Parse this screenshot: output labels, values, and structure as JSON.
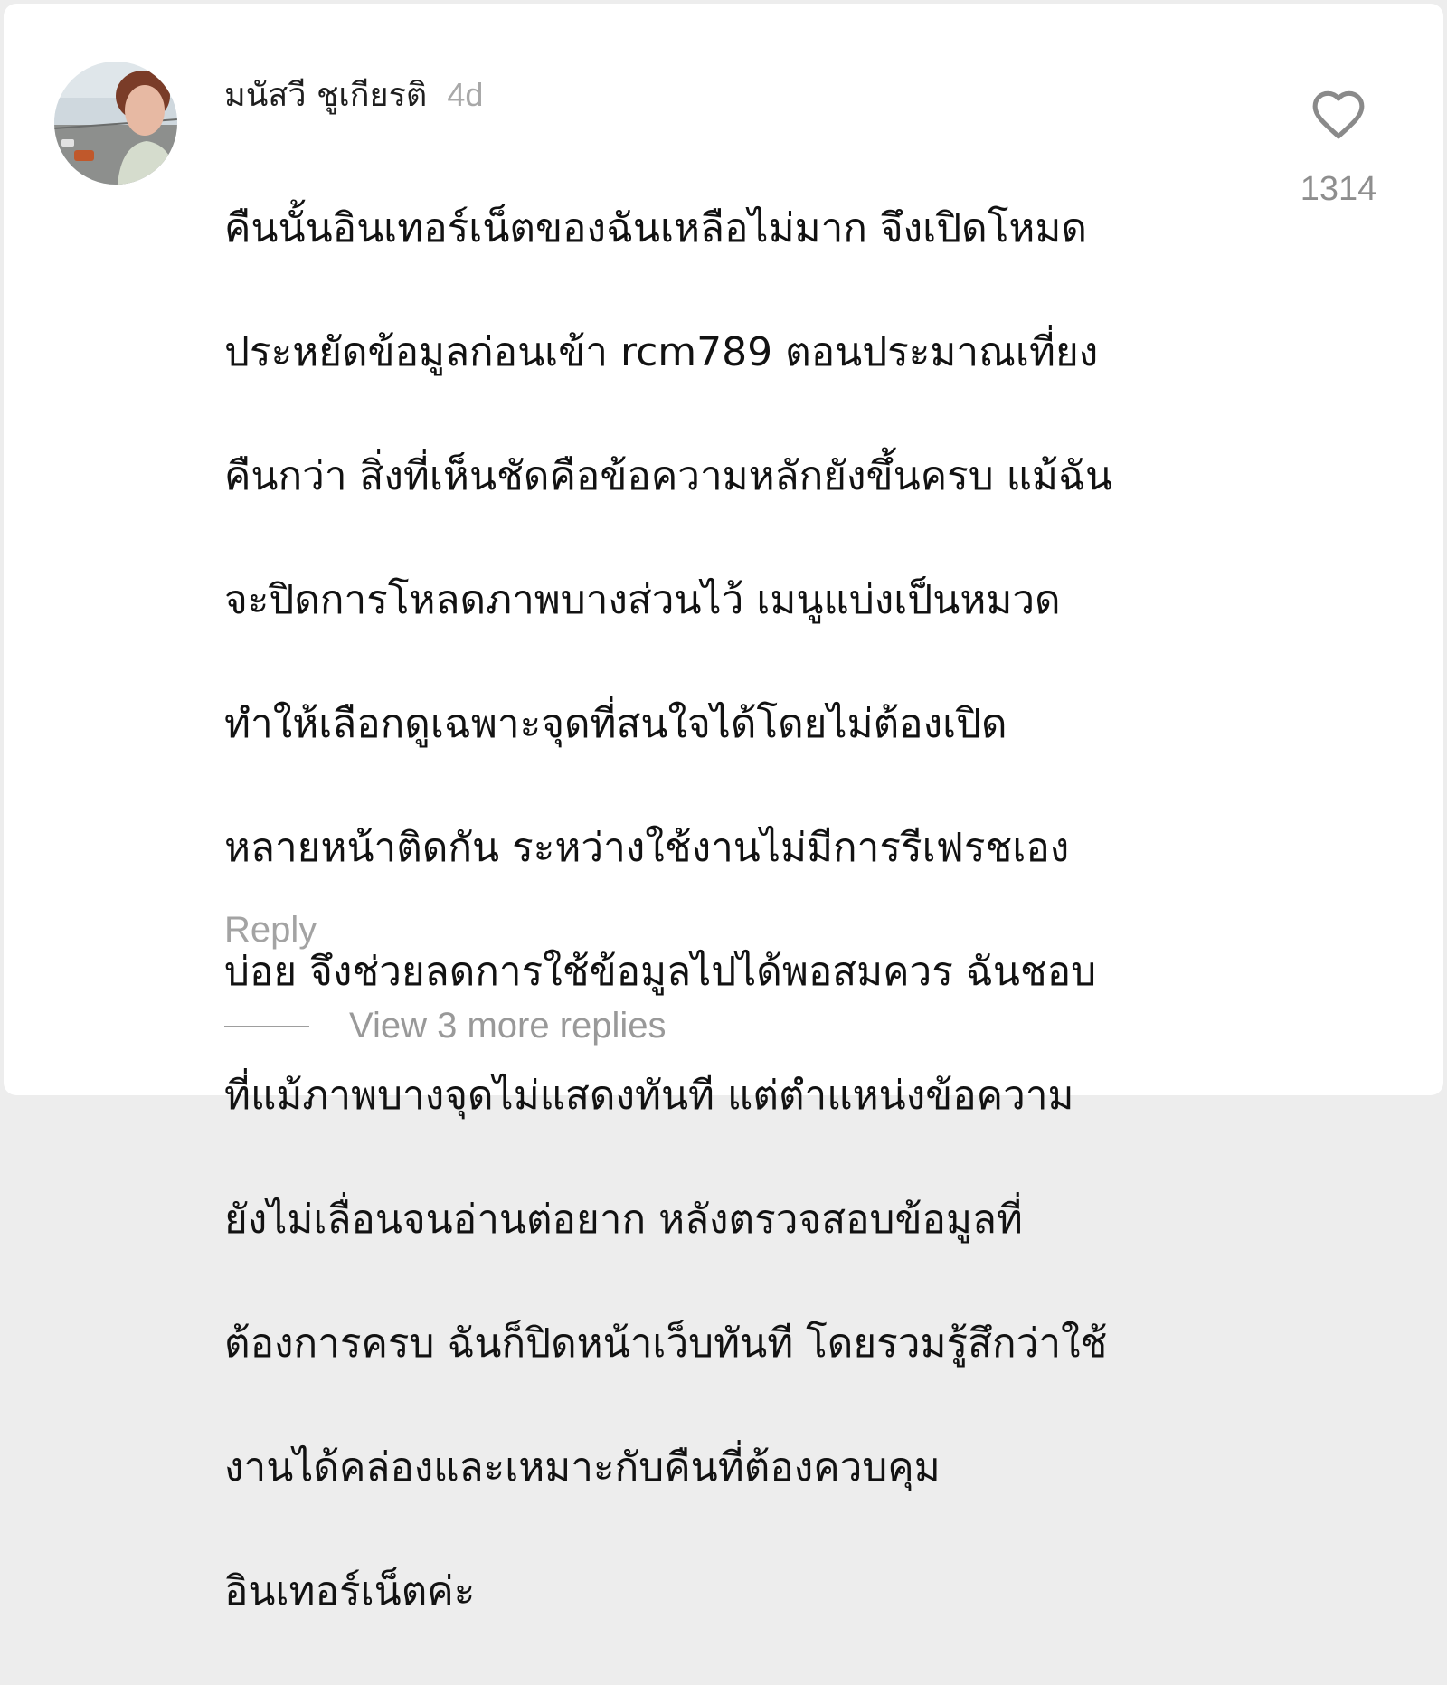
{
  "comment": {
    "author": "มนัสวี ชูเกียรติ",
    "time": "4d",
    "text_lines": [
      "คืนนั้นอินเทอร์เน็ตของฉันเหลือไม่มาก จึงเปิดโหมด",
      "ประหยัดข้อมูลก่อนเข้า rcm789 ตอนประมาณเที่ยง",
      "คืนกว่า สิ่งที่เห็นชัดคือข้อความหลักยังขึ้นครบ แม้ฉัน",
      "จะปิดการโหลดภาพบางส่วนไว้ เมนูแบ่งเป็นหมวด",
      "ทำให้เลือกดูเฉพาะจุดที่สนใจได้โดยไม่ต้องเปิด",
      "หลายหน้าติดกัน ระหว่างใช้งานไม่มีการรีเฟรชเอง",
      "บ่อย จึงช่วยลดการใช้ข้อมูลไปได้พอสมควร ฉันชอบ",
      "ที่แม้ภาพบางจุดไม่แสดงทันที แต่ตำแหน่งข้อความ",
      "ยังไม่เลื่อนจนอ่านต่อยาก หลังตรวจสอบข้อมูลที่",
      "ต้องการครบ ฉันก็ปิดหน้าเว็บทันที โดยรวมรู้สึกว่าใช้",
      "งานได้คล่องและเหมาะกับคืนที่ต้องควบคุม",
      "อินเทอร์เน็ตค่ะ"
    ],
    "like_count": "1314",
    "like_icon": "heart-outline-icon",
    "reply_label": "Reply",
    "view_more_label": "View 3 more replies"
  }
}
